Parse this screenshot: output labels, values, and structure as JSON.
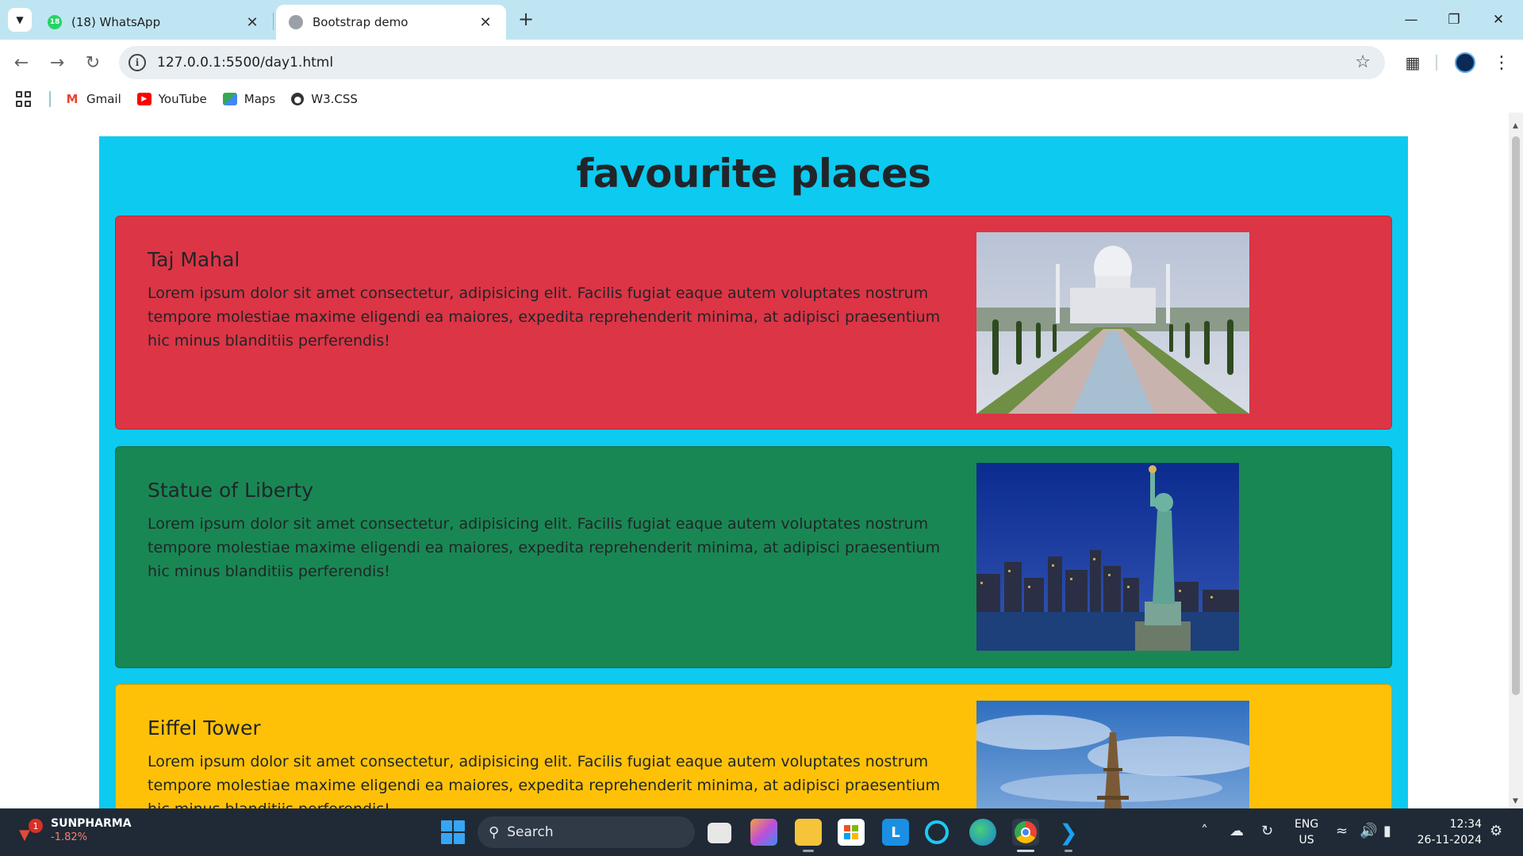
{
  "browser": {
    "tabs": [
      {
        "title": "(18) WhatsApp",
        "badge": "18",
        "active": false
      },
      {
        "title": "Bootstrap demo",
        "active": true
      }
    ],
    "url": "127.0.0.1:5500/day1.html",
    "bookmarks": [
      {
        "label": "Gmail",
        "icon": "gmail-icon"
      },
      {
        "label": "YouTube",
        "icon": "youtube-icon"
      },
      {
        "label": "Maps",
        "icon": "maps-icon"
      },
      {
        "label": "W3.CSS",
        "icon": "globe-icon"
      }
    ]
  },
  "page": {
    "title": "favourite places",
    "cards": [
      {
        "title": "Taj Mahal",
        "text": "Lorem ipsum dolor sit amet consectetur, adipisicing elit. Facilis fugiat eaque autem voluptates nostrum tempore molestiae maxime eligendi ea maiores, expedita reprehenderit minima, at adipisci praesentium hic minus blanditiis perferendis!",
        "bg": "#dc3545",
        "image_alt": "Taj Mahal photo"
      },
      {
        "title": "Statue of Liberty",
        "text": "Lorem ipsum dolor sit amet consectetur, adipisicing elit. Facilis fugiat eaque autem voluptates nostrum tempore molestiae maxime eligendi ea maiores, expedita reprehenderit minima, at adipisci praesentium hic minus blanditiis perferendis!",
        "bg": "#198754",
        "image_alt": "Statue of Liberty photo"
      },
      {
        "title": "Eiffel Tower",
        "text": "Lorem ipsum dolor sit amet consectetur, adipisicing elit. Facilis fugiat eaque autem voluptates nostrum tempore molestiae maxime eligendi ea maiores, expedita reprehenderit minima, at adipisci praesentium hic minus blanditiis perferendis!",
        "bg": "#ffc107",
        "image_alt": "Eiffel Tower photo"
      }
    ],
    "container_bg": "#0dcaf0"
  },
  "taskbar": {
    "stock_name": "SUNPHARMA",
    "stock_change": "-1.82%",
    "stock_badge": "1",
    "search_label": "Search",
    "lang_line1": "ENG",
    "lang_line2": "US",
    "time": "12:34",
    "date": "26-11-2024"
  }
}
